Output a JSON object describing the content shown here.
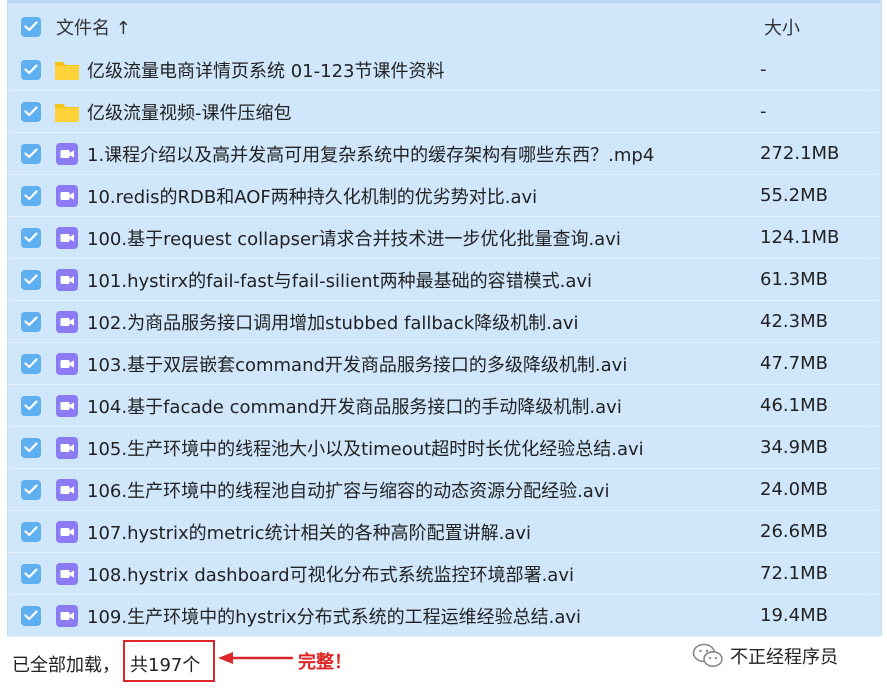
{
  "header": {
    "name_label": "文件名 ↑",
    "size_label": "大小"
  },
  "files": [
    {
      "type": "folder",
      "name": "亿级流量电商详情页系统 01-123节课件资料",
      "size": "-"
    },
    {
      "type": "folder",
      "name": "亿级流量视频-课件压缩包",
      "size": "-"
    },
    {
      "type": "video",
      "name": "1.课程介绍以及高并发高可用复杂系统中的缓存架构有哪些东西？.mp4",
      "size": "272.1MB"
    },
    {
      "type": "video",
      "name": "10.redis的RDB和AOF两种持久化机制的优劣势对比.avi",
      "size": "55.2MB"
    },
    {
      "type": "video",
      "name": "100.基于request collapser请求合并技术进一步优化批量查询.avi",
      "size": "124.1MB"
    },
    {
      "type": "video",
      "name": "101.hystirx的fail-fast与fail-silient两种最基础的容错模式.avi",
      "size": "61.3MB"
    },
    {
      "type": "video",
      "name": "102.为商品服务接口调用增加stubbed fallback降级机制.avi",
      "size": "42.3MB"
    },
    {
      "type": "video",
      "name": "103.基于双层嵌套command开发商品服务接口的多级降级机制.avi",
      "size": "47.7MB"
    },
    {
      "type": "video",
      "name": "104.基于facade command开发商品服务接口的手动降级机制.avi",
      "size": "46.1MB"
    },
    {
      "type": "video",
      "name": "105.生产环境中的线程池大小以及timeout超时时长优化经验总结.avi",
      "size": "34.9MB"
    },
    {
      "type": "video",
      "name": "106.生产环境中的线程池自动扩容与缩容的动态资源分配经验.avi",
      "size": "24.0MB"
    },
    {
      "type": "video",
      "name": "107.hystrix的metric统计相关的各种高阶配置讲解.avi",
      "size": "26.6MB"
    },
    {
      "type": "video",
      "name": "108.hystrix dashboard可视化分布式系统监控环境部署.avi",
      "size": "72.1MB"
    },
    {
      "type": "video",
      "name": "109.生产环境中的hystrix分布式系统的工程运维经验总结.avi",
      "size": "19.4MB"
    }
  ],
  "footer": {
    "loaded_text": "已全部加载，",
    "count_text": "共197个",
    "annotation": "完整！",
    "annotation_color": "#e02424"
  },
  "watermark": {
    "text": "不正经程序员",
    "icon": "wechat-icon"
  },
  "colors": {
    "checkbox": "#5fb0f0",
    "folder": "#f7c31b",
    "video": "#8b7cf6",
    "selected_bg": "#cfe6fb"
  }
}
